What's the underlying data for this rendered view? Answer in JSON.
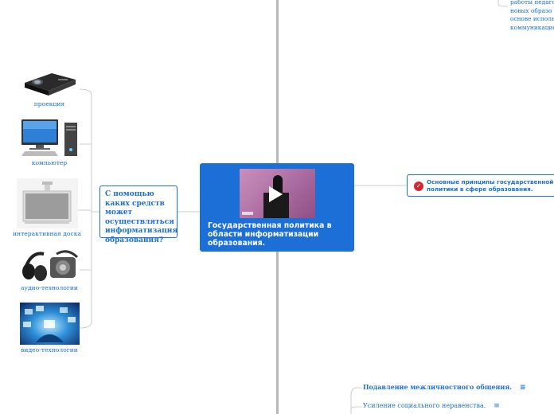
{
  "central": {
    "title": "Государственная политика в области информатизации образования."
  },
  "question_node": {
    "label": "С помощью каких средств может осуществляться информатизация образования?"
  },
  "principles_node": {
    "label": "Основные принципы государственной политики в сфере образования."
  },
  "top_partial_lines": [
    "работы педаго",
    "новых образо",
    "основе исполь",
    "коммуникацио"
  ],
  "means": [
    {
      "label": "проекция",
      "icon": "projector-icon"
    },
    {
      "label": "компьютер",
      "icon": "computer-icon"
    },
    {
      "label": "интерактивная доска",
      "icon": "interactive-board-icon"
    },
    {
      "label": "аудио-технологии",
      "icon": "headphones-icon"
    },
    {
      "label": "видео-технологии",
      "icon": "video-tech-icon"
    }
  ],
  "bottom_items": [
    {
      "label": "Подавление межличностного общения.",
      "notes": "≡"
    },
    {
      "label": "Усиление социального неравенства.",
      "notes": "≡"
    }
  ],
  "colors": {
    "accent": "#1b6fd6",
    "check": "#d4272f",
    "connector": "#cccccc",
    "divider": "#b9b9b9"
  }
}
